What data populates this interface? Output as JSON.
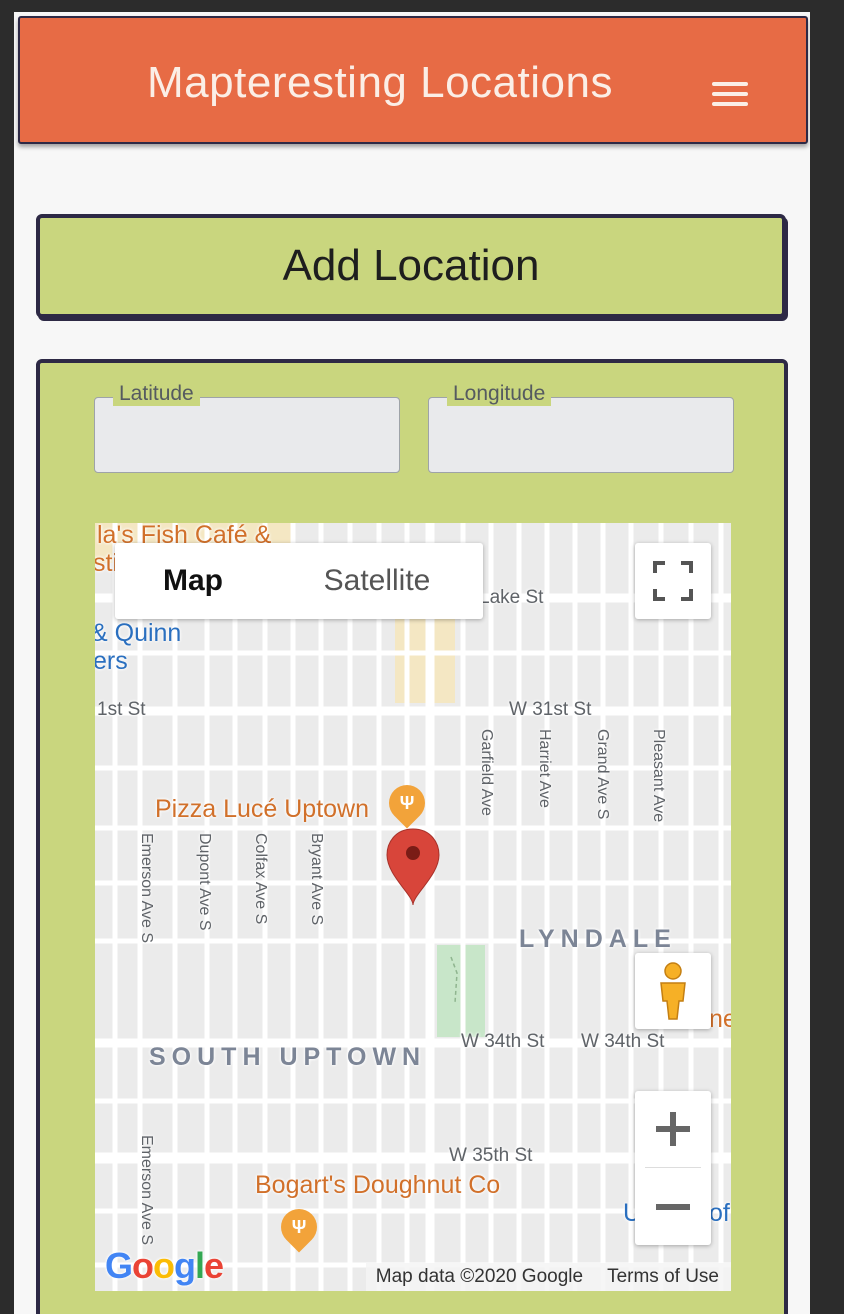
{
  "header": {
    "title": "Mapteresting Locations",
    "menu_icon": "hamburger-menu-icon"
  },
  "add_location": {
    "label": "Add Location"
  },
  "form": {
    "latitude": {
      "label": "Latitude",
      "value": "",
      "placeholder": ""
    },
    "longitude": {
      "label": "Longitude",
      "value": "",
      "placeholder": ""
    }
  },
  "map": {
    "type_control": {
      "map_label": "Map",
      "satellite_label": "Satellite",
      "selected": "Map"
    },
    "fullscreen_icon": "fullscreen-icon",
    "pegman_icon": "street-view-pegman-icon",
    "zoom_in_label": "+",
    "zoom_out_label": "−",
    "attribution": {
      "data": "Map data ©2020 Google",
      "terms": "Terms of Use"
    },
    "logo_text": "Google",
    "labels": {
      "poi_fish_cafe": "la's Fish Café &",
      "poi_fish_cafe_2": "sti",
      "poi_quinn": "& Quinn",
      "poi_quinn_2": "ers",
      "st_31_left": "1st St",
      "st_w31": "W 31st St",
      "st_lake": "Lake St",
      "poi_pizza": "Pizza Lucé Uptown",
      "av_garfield": "Garfield Ave",
      "av_harriet": "Harriet Ave",
      "av_grand": "Grand Ave S",
      "av_pleasant": "Pleasant Ave",
      "av_emerson": "Emerson Ave S",
      "av_dupont": "Dupont Ave S",
      "av_colfax": "Colfax Ave S",
      "av_bryant": "Bryant Ave S",
      "hood_lyndale": "LYNDALE",
      "hood_south_uptown": "SOUTH UPTOWN",
      "st_w34_a": "W 34th St",
      "st_w34_b": "W 34th St",
      "st_w35": "W 35th St",
      "poi_bogarts": "Bogart's Doughnut Co",
      "av_emerson_2": "Emerson Ave S",
      "poi_edge_right": "ne",
      "poi_edge_u": "U",
      "poi_edge_of": "of"
    },
    "marker_color": "#d8453a"
  },
  "colors": {
    "header_bg": "#e76b45",
    "accent_green": "#c9d67e",
    "border_dark": "#2d2945"
  }
}
